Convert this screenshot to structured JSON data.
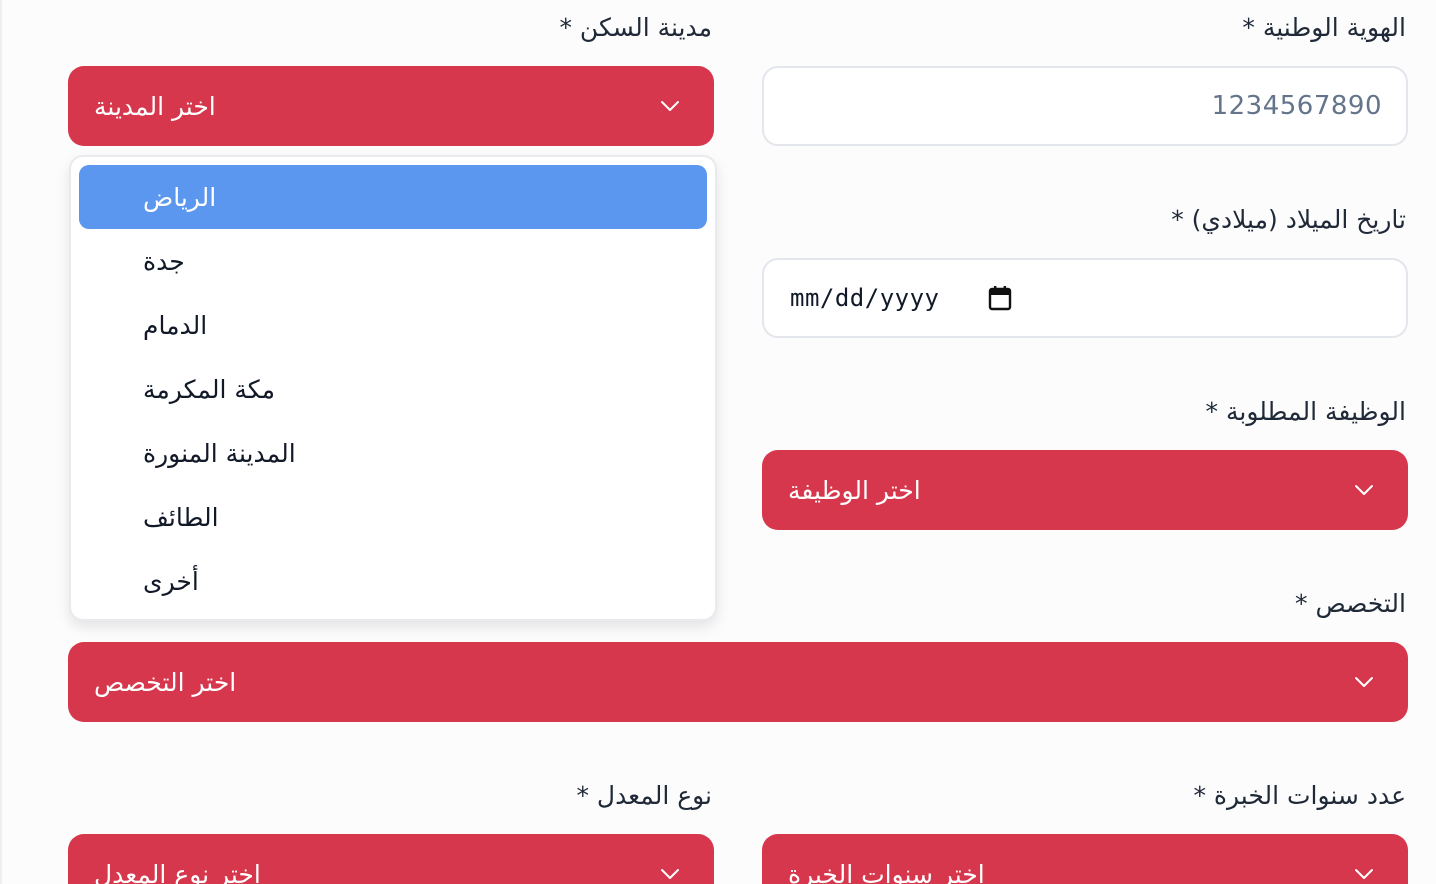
{
  "national_id": {
    "label": "الهوية الوطنية *",
    "value": "1234567890"
  },
  "residence_city": {
    "label": "مدينة السكن *",
    "placeholder": "اختر المدينة",
    "options": [
      "الرياض",
      "جدة",
      "الدمام",
      "مكة المكرمة",
      "المدينة المنورة",
      "الطائف",
      "أخرى"
    ],
    "highlighted": "الرياض"
  },
  "birth_date": {
    "label": "تاريخ الميلاد (ميلادي) *",
    "value": "mm/dd/yyyy"
  },
  "job": {
    "label": "الوظيفة المطلوبة *",
    "placeholder": "اختر الوظيفة"
  },
  "specialization": {
    "label": "التخصص *",
    "placeholder": "اختر التخصص"
  },
  "experience_years": {
    "label": "عدد سنوات الخبرة *",
    "placeholder": "اختر سنوات الخبرة"
  },
  "gpa_type": {
    "label": "نوع المعدل *",
    "placeholder": "اختر نوع المعدل"
  },
  "icons": {
    "select_arrow": "chevron-down-icon",
    "date_picker": "calendar-icon"
  },
  "colors": {
    "select_bg": "#d6374c",
    "option_highlight": "#5b97ef",
    "input_border": "#e3e6ec"
  }
}
